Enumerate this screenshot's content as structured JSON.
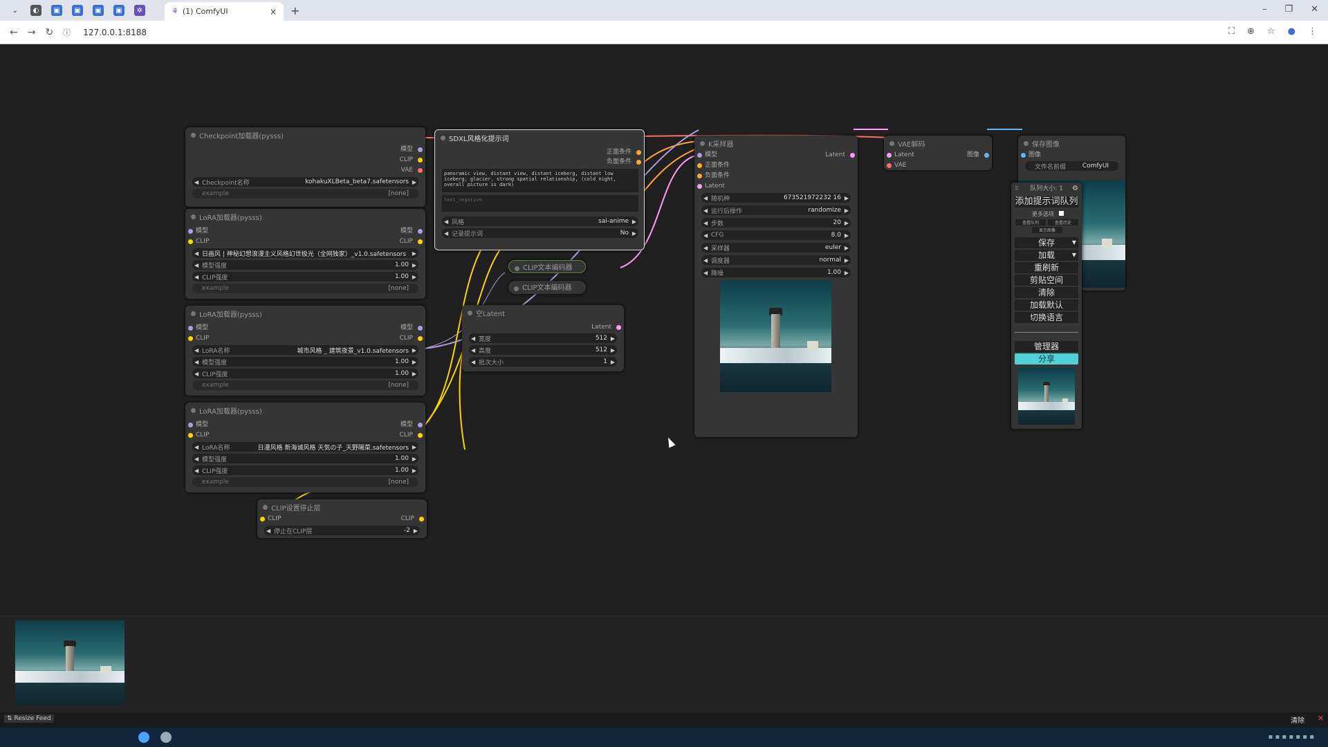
{
  "browser": {
    "tab_title": "(1) ComfyUI",
    "url": "127.0.0.1:8188",
    "new_tab": "+",
    "close_tab": "×"
  },
  "nodes": {
    "checkpoint": {
      "title": "Checkpoint加载器(pysss)",
      "outputs": [
        "模型",
        "CLIP",
        "VAE"
      ],
      "widget_label": "Checkpoint名称",
      "widget_value": "kohakuXLBeta_beta7.safetensors",
      "example_label": "example",
      "example_value": "[none]"
    },
    "lora1": {
      "title": "LoRA加载器(pysss)",
      "inputs": [
        "模型",
        "CLIP"
      ],
      "outputs": [
        "模型",
        "CLIP"
      ],
      "lora_value": "日画风 | 神秘幻想浪漫主义风格幻世极光（全网独家）_v1.0.safetensors",
      "model_strength_label": "模型强度",
      "model_strength": "1.00",
      "clip_strength_label": "CLIP强度",
      "clip_strength": "1.00",
      "example_label": "example",
      "example_value": "[none]"
    },
    "lora2": {
      "title": "LoRA加载器(pysss)",
      "inputs": [
        "模型",
        "CLIP"
      ],
      "outputs": [
        "模型",
        "CLIP"
      ],
      "lora_label": "LoRA名称",
      "lora_value": "城市风格 _ 建筑夜景_v1.0.safetensors",
      "model_strength_label": "模型强度",
      "model_strength": "1.00",
      "clip_strength_label": "CLIP强度",
      "clip_strength": "1.00",
      "example_label": "example",
      "example_value": "[none]"
    },
    "lora3": {
      "title": "LoRA加载器(pysss)",
      "inputs": [
        "模型",
        "CLIP"
      ],
      "outputs": [
        "模型",
        "CLIP"
      ],
      "lora_label": "LoRA名称",
      "lora_value": "日漫风格 新海诚风格 天気の子_天野陽菜.safetensors",
      "model_strength_label": "模型强度",
      "model_strength": "1.00",
      "clip_strength_label": "CLIP强度",
      "clip_strength": "1.00",
      "example_label": "example",
      "example_value": "[none]"
    },
    "clipstop": {
      "title": "CLIP设置停止层",
      "input": "CLIP",
      "output": "CLIP",
      "widget_label": "停止在CLIP层",
      "widget_value": "-2"
    },
    "sdxl": {
      "title": "SDXL风格化提示词",
      "outputs": [
        "正面条件",
        "负面条件"
      ],
      "positive_text": "panoramic view, distant view, distant iceberg, distant low iceberg, glacier, strong spatial relationship, (cold night, overall picture is dark)",
      "negative_placeholder": "text_negative",
      "style_label": "风格",
      "style_value": "sai-anime",
      "log_label": "记录提示词",
      "log_value": "No"
    },
    "clipenc1": {
      "title": "CLIP文本编码器"
    },
    "clipenc2": {
      "title": "CLIP文本编码器"
    },
    "latent": {
      "title": "空Latent",
      "output": "Latent",
      "width_label": "宽度",
      "width": "512",
      "height_label": "高度",
      "height": "512",
      "batch_label": "批次大小",
      "batch": "1"
    },
    "ksampler": {
      "title": "K采样器",
      "inputs": [
        "模型",
        "正面条件",
        "负面条件",
        "Latent"
      ],
      "output": "Latent",
      "seed_label": "随机种",
      "seed": "673521972232 16",
      "after_label": "运行后操作",
      "after": "randomize",
      "steps_label": "步数",
      "steps": "20",
      "cfg_label": "CFG",
      "cfg": "8.0",
      "sampler_label": "采样器",
      "sampler": "euler",
      "scheduler_label": "调度器",
      "scheduler": "normal",
      "denoise_label": "降噪",
      "denoise": "1.00"
    },
    "vae": {
      "title": "VAE解码",
      "inputs": [
        "Latent",
        "VAE"
      ],
      "output": "图像"
    },
    "save": {
      "title": "保存图像",
      "input": "图像",
      "prefix_label": "文件名前缀",
      "prefix_value": "ComfyUI"
    }
  },
  "menu": {
    "queue_size": "队列大小: 1",
    "queue_prompt": "添加提示词队列",
    "extra_options": "更多选项",
    "view_queue": "查看队列",
    "view_history": "查看历史",
    "view_stream": "显示图像",
    "save": "保存",
    "load": "加载",
    "refresh": "重刷新",
    "clipspace": "剪贴空间",
    "clear": "清除",
    "load_default": "加载默认",
    "switch_lang": "切换语言",
    "manager": "管理器",
    "share": "分享"
  },
  "feed": {
    "resize_label": "Resize Feed",
    "clear_label": "清除"
  },
  "colors": {
    "clip": "#ffd500",
    "model": "#b39ddb",
    "vae": "#ff6e6e",
    "cond": "#ffa931",
    "latent": "#ff9cf9",
    "image": "#64b5f6",
    "share": "#4fd1d9"
  }
}
